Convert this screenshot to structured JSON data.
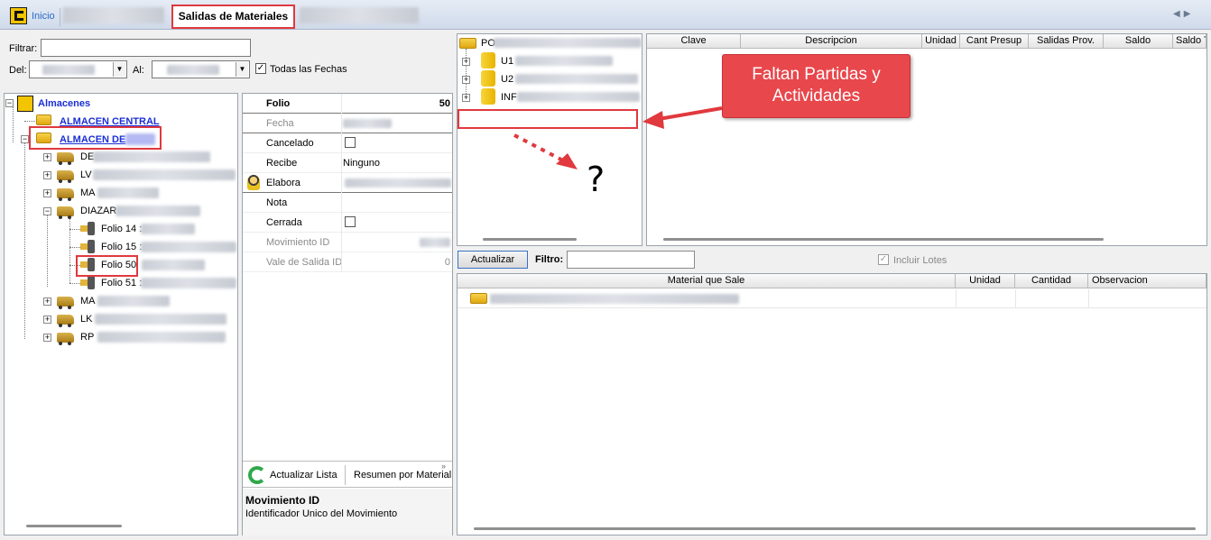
{
  "tabs": {
    "home": "Inicio",
    "active": "Salidas de Materiales"
  },
  "filter": {
    "filtrar_label": "Filtrar:",
    "del_label": "Del:",
    "al_label": "Al:",
    "todas_label": "Todas las Fechas",
    "todas_checked": true
  },
  "tree": {
    "root": "Almacenes",
    "central": "ALMACEN CENTRAL",
    "almacen_de": "ALMACEN DE",
    "children": [
      "DE",
      "LV",
      "MA",
      "DIAZAR",
      "MA",
      "LK",
      "RP"
    ],
    "folios": [
      "Folio 14 :",
      "Folio 15 :",
      "Folio 50",
      "Folio 51 :"
    ]
  },
  "props": {
    "folio_label": "Folio",
    "folio_value": "50",
    "fecha_label": "Fecha",
    "cancelado_label": "Cancelado",
    "recibe_label": "Recibe",
    "recibe_value": "Ninguno",
    "elabora_label": "Elabora",
    "nota_label": "Nota",
    "cerrada_label": "Cerrada",
    "movimiento_label": "Movimiento ID",
    "vale_label": "Vale de Salida ID",
    "vale_value": "0",
    "actualizar_lista": "Actualizar Lista",
    "resumen": "Resumen por Material",
    "desc_title": "Movimiento ID",
    "desc_text": "Identificador Unico del Movimiento"
  },
  "mid_tree": {
    "root": "PO",
    "items": [
      "U1",
      "U2",
      "INF"
    ]
  },
  "grid1": {
    "columns": [
      "Clave",
      "Descripcion",
      "Unidad",
      "Cant Presup",
      "Salidas Prov.",
      "Saldo",
      "Saldo T"
    ]
  },
  "toolbar": {
    "actualizar": "Actualizar",
    "filtro_label": "Filtro:",
    "incluir_lotes": "Incluir Lotes"
  },
  "grid2": {
    "columns": [
      "Material que Sale",
      "Unidad",
      "Cantidad",
      "Observacion"
    ]
  },
  "annotation": {
    "callout": "Faltan Partidas y Actividades",
    "question": "?"
  },
  "colors": {
    "highlight": "#e0393e",
    "callout_bg": "#e8474c",
    "link_blue": "#1a2fd6"
  }
}
